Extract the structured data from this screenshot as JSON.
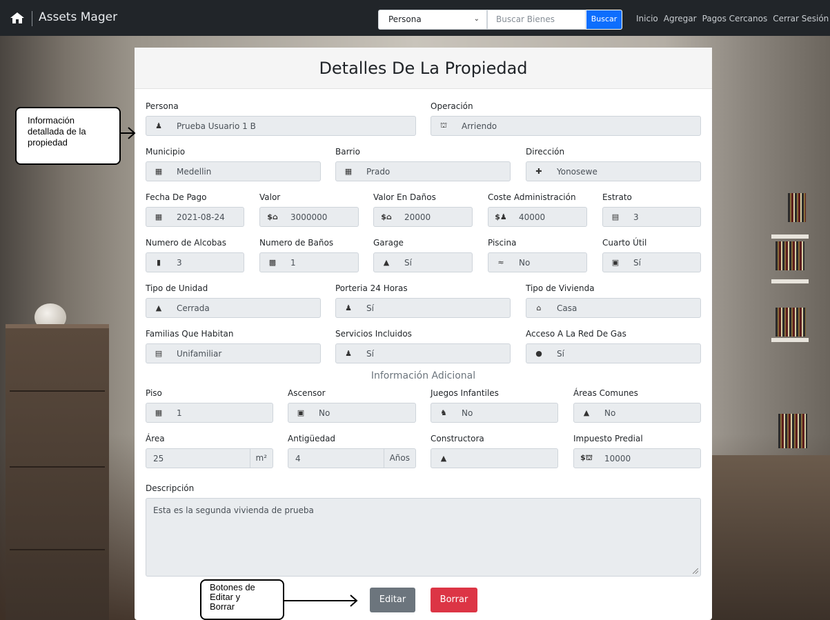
{
  "navbar": {
    "brand": "Assets Mager",
    "select_value": "Persona",
    "search_placeholder": "Buscar Bienes",
    "search_button": "Buscar",
    "links": [
      "Inicio",
      "Agregar",
      "Pagos Cercanos",
      "Cerrar Sesión"
    ]
  },
  "card": {
    "title": "Detalles De La Propiedad",
    "section_title": "Información Adicional"
  },
  "fields": {
    "persona": {
      "label": "Persona",
      "value": "Prueba Usuario 1 B",
      "icon": "user-icon"
    },
    "operacion": {
      "label": "Operación",
      "value": "Arriendo",
      "icon": "bank-icon"
    },
    "municipio": {
      "label": "Municipio",
      "value": "Medellin",
      "icon": "city-icon"
    },
    "barrio": {
      "label": "Barrio",
      "value": "Prado",
      "icon": "map-icon"
    },
    "direccion": {
      "label": "Dirección",
      "value": "Yonosewe",
      "icon": "signpost-icon"
    },
    "fecha_pago": {
      "label": "Fecha De Pago",
      "value": "2021-08-24",
      "icon": "calendar-icon"
    },
    "valor": {
      "label": "Valor",
      "value": "3000000",
      "icon": "money-house-icon"
    },
    "valor_danos": {
      "label": "Valor En Daños",
      "value": "20000",
      "icon": "money-house-icon"
    },
    "coste_admin": {
      "label": "Coste Administración",
      "value": "40000",
      "icon": "money-user-icon"
    },
    "estrato": {
      "label": "Estrato",
      "value": "3",
      "icon": "chart-icon"
    },
    "alcobas": {
      "label": "Numero de Alcobas",
      "value": "3",
      "icon": "door-icon"
    },
    "banos": {
      "label": "Numero de Baños",
      "value": "1",
      "icon": "toilet-icon"
    },
    "garage": {
      "label": "Garage",
      "value": "Sí",
      "icon": "car-icon"
    },
    "piscina": {
      "label": "Piscina",
      "value": "No",
      "icon": "swimmer-icon"
    },
    "cuarto_util": {
      "label": "Cuarto Útil",
      "value": "Sí",
      "icon": "toolbox-icon"
    },
    "tipo_unidad": {
      "label": "Tipo de Unidad",
      "value": "Cerrada",
      "icon": "warehouse-icon"
    },
    "porteria": {
      "label": "Porteria 24 Horas",
      "value": "Sí",
      "icon": "guard-icon"
    },
    "tipo_vivienda": {
      "label": "Tipo de Vivienda",
      "value": "Casa",
      "icon": "home-icon"
    },
    "familias": {
      "label": "Familias Que Habitan",
      "value": "Unifamiliar",
      "icon": "bed-icon"
    },
    "servicios": {
      "label": "Servicios Incluidos",
      "value": "Sí",
      "icon": "hand-holding-icon"
    },
    "gas": {
      "label": "Acceso A La Red De Gas",
      "value": "Sí",
      "icon": "flame-icon"
    },
    "piso": {
      "label": "Piso",
      "value": "1",
      "icon": "building-icon"
    },
    "ascensor": {
      "label": "Ascensor",
      "value": "No",
      "icon": "elevator-icon"
    },
    "juegos": {
      "label": "Juegos Infantiles",
      "value": "No",
      "icon": "playground-icon"
    },
    "areas_comunes": {
      "label": "Áreas Comunes",
      "value": "No",
      "icon": "tree-icon"
    },
    "area": {
      "label": "Área",
      "value": "25",
      "suffix": "m²"
    },
    "antiguedad": {
      "label": "Antigüedad",
      "value": "4",
      "suffix": "Años"
    },
    "constructora": {
      "label": "Constructora",
      "value": "",
      "icon": "hardhat-icon"
    },
    "impuesto": {
      "label": "Impuesto Predial",
      "value": "10000",
      "icon": "money-bank-icon"
    },
    "descripcion": {
      "label": "Descripción",
      "value": "Esta es la segunda vivienda de prueba"
    }
  },
  "buttons": {
    "edit": "Editar",
    "delete": "Borrar"
  },
  "callouts": {
    "info": [
      "Información",
      "detallada de la",
      "propiedad"
    ],
    "buttons": [
      "Botones de",
      "Editar y",
      "Borrar"
    ]
  }
}
